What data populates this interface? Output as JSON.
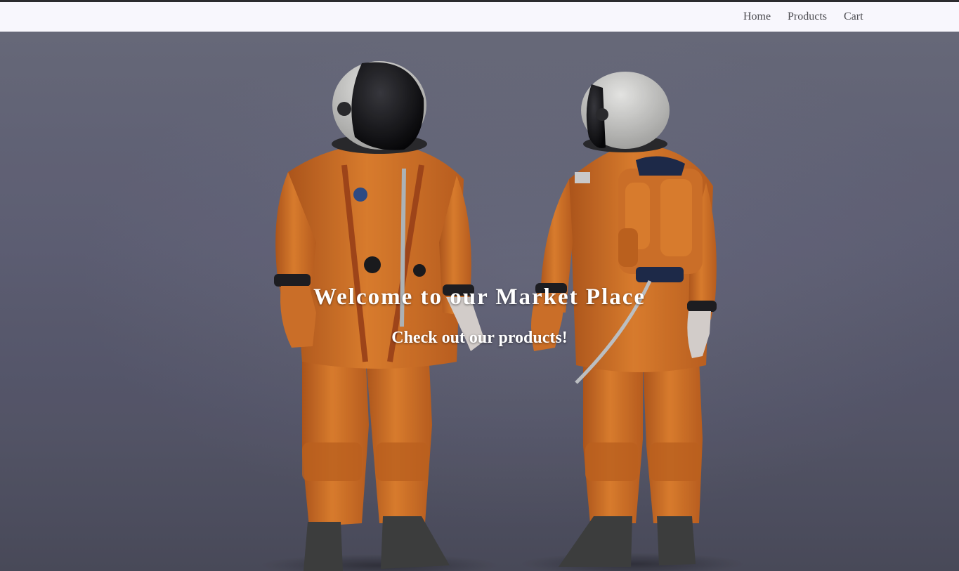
{
  "nav": {
    "links": [
      "Home",
      "Products",
      "Cart"
    ]
  },
  "hero": {
    "image": "astronauts-in-orange-suits",
    "heading": "Welcome to our Market Place",
    "subheading": "Check out our products!"
  },
  "colors": {
    "navbar_bg": "#f8f7fd",
    "nav_text": "#4d4d52",
    "hero_bg": "#62637a",
    "suit_orange": "#e0782a",
    "hero_text": "#ffffff"
  }
}
